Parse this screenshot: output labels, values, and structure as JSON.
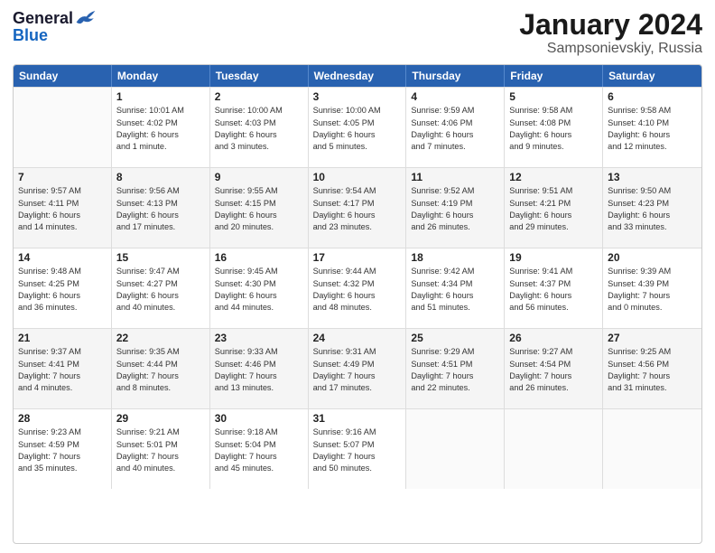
{
  "logo": {
    "general": "General",
    "blue": "Blue"
  },
  "title": "January 2024",
  "subtitle": "Sampsonievskiy, Russia",
  "header_days": [
    "Sunday",
    "Monday",
    "Tuesday",
    "Wednesday",
    "Thursday",
    "Friday",
    "Saturday"
  ],
  "weeks": [
    [
      {
        "day": "",
        "lines": []
      },
      {
        "day": "1",
        "lines": [
          "Sunrise: 10:01 AM",
          "Sunset: 4:02 PM",
          "Daylight: 6 hours",
          "and 1 minute."
        ]
      },
      {
        "day": "2",
        "lines": [
          "Sunrise: 10:00 AM",
          "Sunset: 4:03 PM",
          "Daylight: 6 hours",
          "and 3 minutes."
        ]
      },
      {
        "day": "3",
        "lines": [
          "Sunrise: 10:00 AM",
          "Sunset: 4:05 PM",
          "Daylight: 6 hours",
          "and 5 minutes."
        ]
      },
      {
        "day": "4",
        "lines": [
          "Sunrise: 9:59 AM",
          "Sunset: 4:06 PM",
          "Daylight: 6 hours",
          "and 7 minutes."
        ]
      },
      {
        "day": "5",
        "lines": [
          "Sunrise: 9:58 AM",
          "Sunset: 4:08 PM",
          "Daylight: 6 hours",
          "and 9 minutes."
        ]
      },
      {
        "day": "6",
        "lines": [
          "Sunrise: 9:58 AM",
          "Sunset: 4:10 PM",
          "Daylight: 6 hours",
          "and 12 minutes."
        ]
      }
    ],
    [
      {
        "day": "7",
        "lines": [
          "Sunrise: 9:57 AM",
          "Sunset: 4:11 PM",
          "Daylight: 6 hours",
          "and 14 minutes."
        ]
      },
      {
        "day": "8",
        "lines": [
          "Sunrise: 9:56 AM",
          "Sunset: 4:13 PM",
          "Daylight: 6 hours",
          "and 17 minutes."
        ]
      },
      {
        "day": "9",
        "lines": [
          "Sunrise: 9:55 AM",
          "Sunset: 4:15 PM",
          "Daylight: 6 hours",
          "and 20 minutes."
        ]
      },
      {
        "day": "10",
        "lines": [
          "Sunrise: 9:54 AM",
          "Sunset: 4:17 PM",
          "Daylight: 6 hours",
          "and 23 minutes."
        ]
      },
      {
        "day": "11",
        "lines": [
          "Sunrise: 9:52 AM",
          "Sunset: 4:19 PM",
          "Daylight: 6 hours",
          "and 26 minutes."
        ]
      },
      {
        "day": "12",
        "lines": [
          "Sunrise: 9:51 AM",
          "Sunset: 4:21 PM",
          "Daylight: 6 hours",
          "and 29 minutes."
        ]
      },
      {
        "day": "13",
        "lines": [
          "Sunrise: 9:50 AM",
          "Sunset: 4:23 PM",
          "Daylight: 6 hours",
          "and 33 minutes."
        ]
      }
    ],
    [
      {
        "day": "14",
        "lines": [
          "Sunrise: 9:48 AM",
          "Sunset: 4:25 PM",
          "Daylight: 6 hours",
          "and 36 minutes."
        ]
      },
      {
        "day": "15",
        "lines": [
          "Sunrise: 9:47 AM",
          "Sunset: 4:27 PM",
          "Daylight: 6 hours",
          "and 40 minutes."
        ]
      },
      {
        "day": "16",
        "lines": [
          "Sunrise: 9:45 AM",
          "Sunset: 4:30 PM",
          "Daylight: 6 hours",
          "and 44 minutes."
        ]
      },
      {
        "day": "17",
        "lines": [
          "Sunrise: 9:44 AM",
          "Sunset: 4:32 PM",
          "Daylight: 6 hours",
          "and 48 minutes."
        ]
      },
      {
        "day": "18",
        "lines": [
          "Sunrise: 9:42 AM",
          "Sunset: 4:34 PM",
          "Daylight: 6 hours",
          "and 51 minutes."
        ]
      },
      {
        "day": "19",
        "lines": [
          "Sunrise: 9:41 AM",
          "Sunset: 4:37 PM",
          "Daylight: 6 hours",
          "and 56 minutes."
        ]
      },
      {
        "day": "20",
        "lines": [
          "Sunrise: 9:39 AM",
          "Sunset: 4:39 PM",
          "Daylight: 7 hours",
          "and 0 minutes."
        ]
      }
    ],
    [
      {
        "day": "21",
        "lines": [
          "Sunrise: 9:37 AM",
          "Sunset: 4:41 PM",
          "Daylight: 7 hours",
          "and 4 minutes."
        ]
      },
      {
        "day": "22",
        "lines": [
          "Sunrise: 9:35 AM",
          "Sunset: 4:44 PM",
          "Daylight: 7 hours",
          "and 8 minutes."
        ]
      },
      {
        "day": "23",
        "lines": [
          "Sunrise: 9:33 AM",
          "Sunset: 4:46 PM",
          "Daylight: 7 hours",
          "and 13 minutes."
        ]
      },
      {
        "day": "24",
        "lines": [
          "Sunrise: 9:31 AM",
          "Sunset: 4:49 PM",
          "Daylight: 7 hours",
          "and 17 minutes."
        ]
      },
      {
        "day": "25",
        "lines": [
          "Sunrise: 9:29 AM",
          "Sunset: 4:51 PM",
          "Daylight: 7 hours",
          "and 22 minutes."
        ]
      },
      {
        "day": "26",
        "lines": [
          "Sunrise: 9:27 AM",
          "Sunset: 4:54 PM",
          "Daylight: 7 hours",
          "and 26 minutes."
        ]
      },
      {
        "day": "27",
        "lines": [
          "Sunrise: 9:25 AM",
          "Sunset: 4:56 PM",
          "Daylight: 7 hours",
          "and 31 minutes."
        ]
      }
    ],
    [
      {
        "day": "28",
        "lines": [
          "Sunrise: 9:23 AM",
          "Sunset: 4:59 PM",
          "Daylight: 7 hours",
          "and 35 minutes."
        ]
      },
      {
        "day": "29",
        "lines": [
          "Sunrise: 9:21 AM",
          "Sunset: 5:01 PM",
          "Daylight: 7 hours",
          "and 40 minutes."
        ]
      },
      {
        "day": "30",
        "lines": [
          "Sunrise: 9:18 AM",
          "Sunset: 5:04 PM",
          "Daylight: 7 hours",
          "and 45 minutes."
        ]
      },
      {
        "day": "31",
        "lines": [
          "Sunrise: 9:16 AM",
          "Sunset: 5:07 PM",
          "Daylight: 7 hours",
          "and 50 minutes."
        ]
      },
      {
        "day": "",
        "lines": []
      },
      {
        "day": "",
        "lines": []
      },
      {
        "day": "",
        "lines": []
      }
    ]
  ]
}
